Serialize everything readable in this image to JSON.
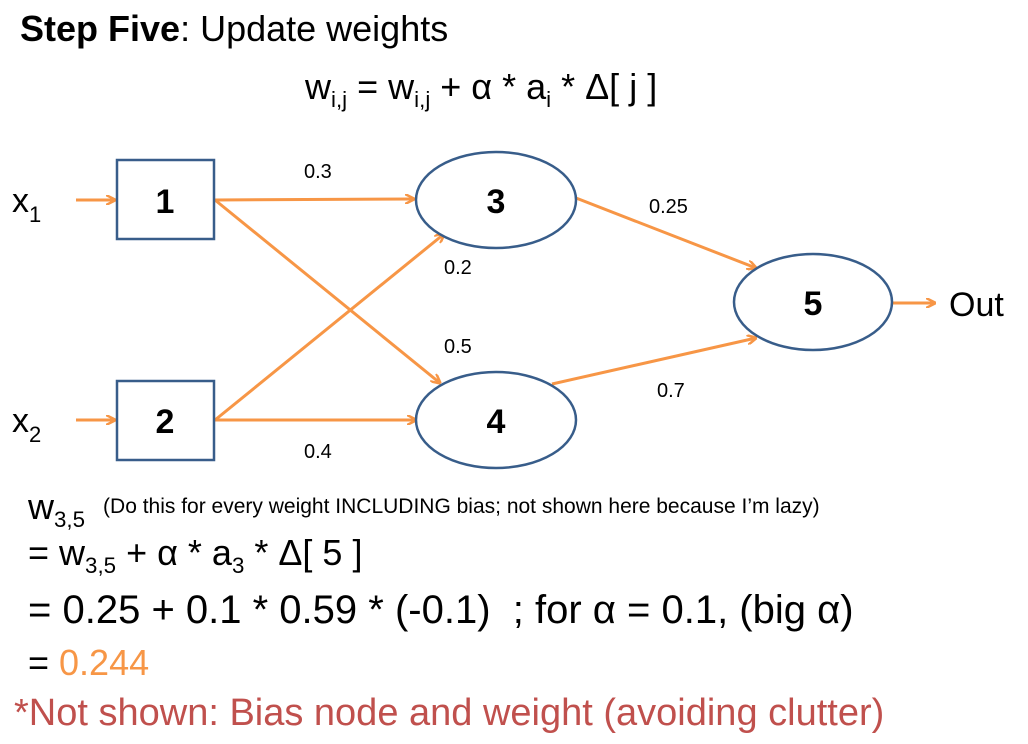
{
  "title": {
    "bold": "Step Five",
    "rest": ": Update weights"
  },
  "formula": {
    "w": "w",
    "sub1": "i,j",
    "eq": " = w",
    "sub2": "i,j",
    "mid": " + α * a",
    "sub3": "i",
    "end": " * Δ[ j ]"
  },
  "network": {
    "nodes": [
      {
        "id": "1",
        "label": "1",
        "shape": "rect"
      },
      {
        "id": "2",
        "label": "2",
        "shape": "rect"
      },
      {
        "id": "3",
        "label": "3",
        "shape": "ellipse"
      },
      {
        "id": "4",
        "label": "4",
        "shape": "ellipse"
      },
      {
        "id": "5",
        "label": "5",
        "shape": "ellipse"
      }
    ],
    "inputs": [
      {
        "label": "x",
        "sub": "1"
      },
      {
        "label": "x",
        "sub": "2"
      }
    ],
    "output": "Out",
    "edges": [
      {
        "from": "1",
        "to": "3",
        "weight": "0.3"
      },
      {
        "from": "2",
        "to": "3",
        "weight": "0.2"
      },
      {
        "from": "1",
        "to": "4",
        "weight": "0.5"
      },
      {
        "from": "2",
        "to": "4",
        "weight": "0.4"
      },
      {
        "from": "3",
        "to": "5",
        "weight": "0.25"
      },
      {
        "from": "4",
        "to": "5",
        "weight": "0.7"
      }
    ],
    "colors": {
      "edge": "#F79646",
      "node_border": "#385D8A",
      "input_arrow": "#F79646"
    }
  },
  "computation": {
    "w35": {
      "w": "w",
      "sub": "3,5"
    },
    "note": "(Do this for every weight INCLUDING bias; not shown here because I’m lazy)",
    "line1": {
      "a": "= w",
      "sub1": "3,5",
      "b": " + α * a",
      "sub2": "3",
      "c": " * Δ[ 5 ]"
    },
    "line2": "= 0.25 + 0.1 * 0.59 * (-0.1)  ; for α = 0.1, (big α)",
    "line3_prefix": "= ",
    "result": "0.244",
    "result_color": "#F79646"
  },
  "footnote": "*Not shown: Bias node and weight (avoiding clutter)",
  "footnote_color": "#C0504D"
}
